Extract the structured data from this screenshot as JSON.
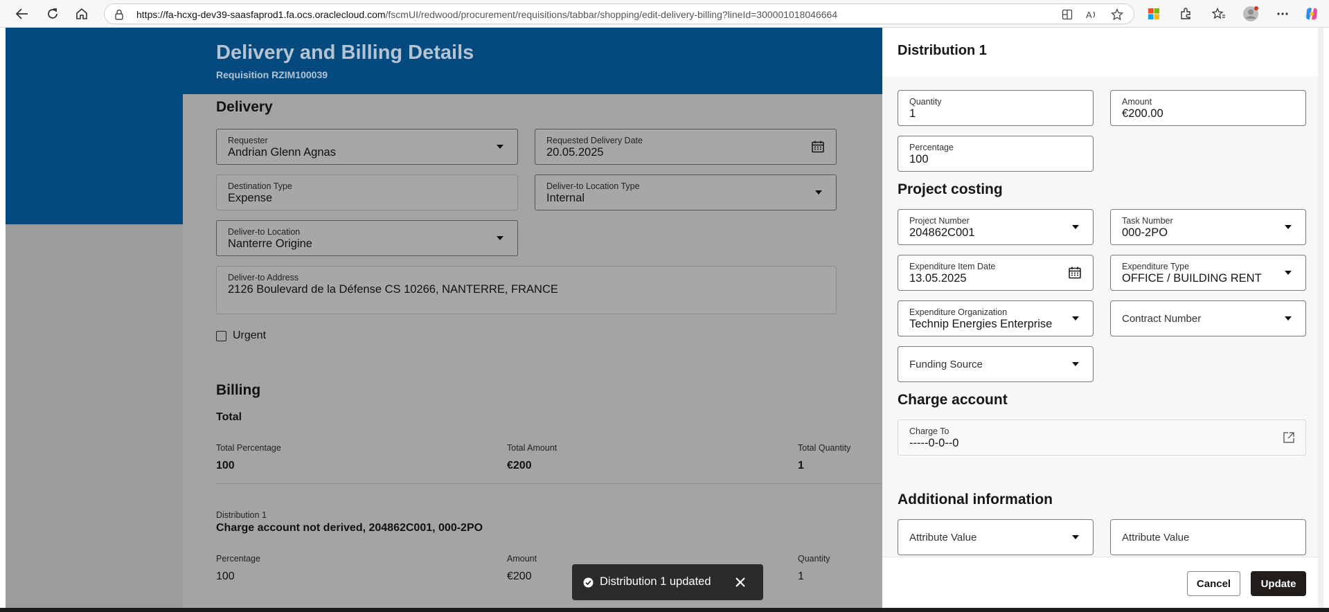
{
  "browser": {
    "url_host": "https://fa-hcxg-dev39-saasfaprod1.fa.ocs.oraclecloud.com",
    "url_path": "/fscmUI/redwood/procurement/requisitions/tabbar/shopping/edit-delivery-billing?lineId=300001018046664",
    "icons": [
      "back-icon",
      "refresh-icon",
      "home-icon",
      "lock-icon",
      "split-view-icon",
      "read-aloud-icon",
      "favorite-star-icon",
      "microsoft-365-icon",
      "extensions-icon",
      "favorites-icon",
      "profile-icon",
      "more-icon",
      "copilot-icon"
    ]
  },
  "page": {
    "title": "Delivery and Billing Details",
    "subtitle": "Requisition RZIM100039"
  },
  "delivery": {
    "section_title": "Delivery",
    "requester_label": "Requester",
    "requester_value": "Andrian Glenn Agnas",
    "date_label": "Requested Delivery Date",
    "date_value": "20.05.2025",
    "dest_type_label": "Destination Type",
    "dest_type_value": "Expense",
    "loc_type_label": "Deliver-to Location Type",
    "loc_type_value": "Internal",
    "location_label": "Deliver-to Location",
    "location_value": "Nanterre Origine",
    "address_label": "Deliver-to Address",
    "address_value": "2126 Boulevard de la Défense CS 10266, NANTERRE, FRANCE",
    "urgent_label": "Urgent"
  },
  "billing": {
    "section_title": "Billing",
    "total_title": "Total",
    "total_pct_label": "Total Percentage",
    "total_pct_value": "100",
    "total_amount_label": "Total Amount",
    "total_amount_value": "€200",
    "total_qty_label": "Total Quantity",
    "total_qty_value": "1",
    "dist_caption": "Distribution 1",
    "dist_summary": "Charge account not derived, 204862C001, 000-2PO",
    "pct_label": "Percentage",
    "pct_value": "100",
    "amount_label": "Amount",
    "amount_value": "€200",
    "qty_label": "Quantity",
    "qty_value": "1"
  },
  "toast": {
    "message": "Distribution 1 updated"
  },
  "drawer": {
    "title": "Distribution 1",
    "quantity_label": "Quantity",
    "quantity_value": "1",
    "amount_label": "Amount",
    "amount_value": "€200.00",
    "percentage_label": "Percentage",
    "percentage_value": "100",
    "project_section": "Project costing",
    "project_number_label": "Project Number",
    "project_number_value": "204862C001",
    "task_number_label": "Task Number",
    "task_number_value": "000-2PO",
    "exp_date_label": "Expenditure Item Date",
    "exp_date_value": "13.05.2025",
    "exp_type_label": "Expenditure Type",
    "exp_type_value": "OFFICE / BUILDING RENT",
    "exp_org_label": "Expenditure Organization",
    "exp_org_value": "Technip Energies Enterprise",
    "contract_label": "Contract Number",
    "funding_label": "Funding Source",
    "charge_section": "Charge account",
    "charge_to_label": "Charge To",
    "charge_to_value": "-----0-0--0",
    "additional_section": "Additional information",
    "attr1_label": "Attribute Value",
    "attr2_label": "Attribute Value",
    "cancel_label": "Cancel",
    "update_label": "Update"
  }
}
